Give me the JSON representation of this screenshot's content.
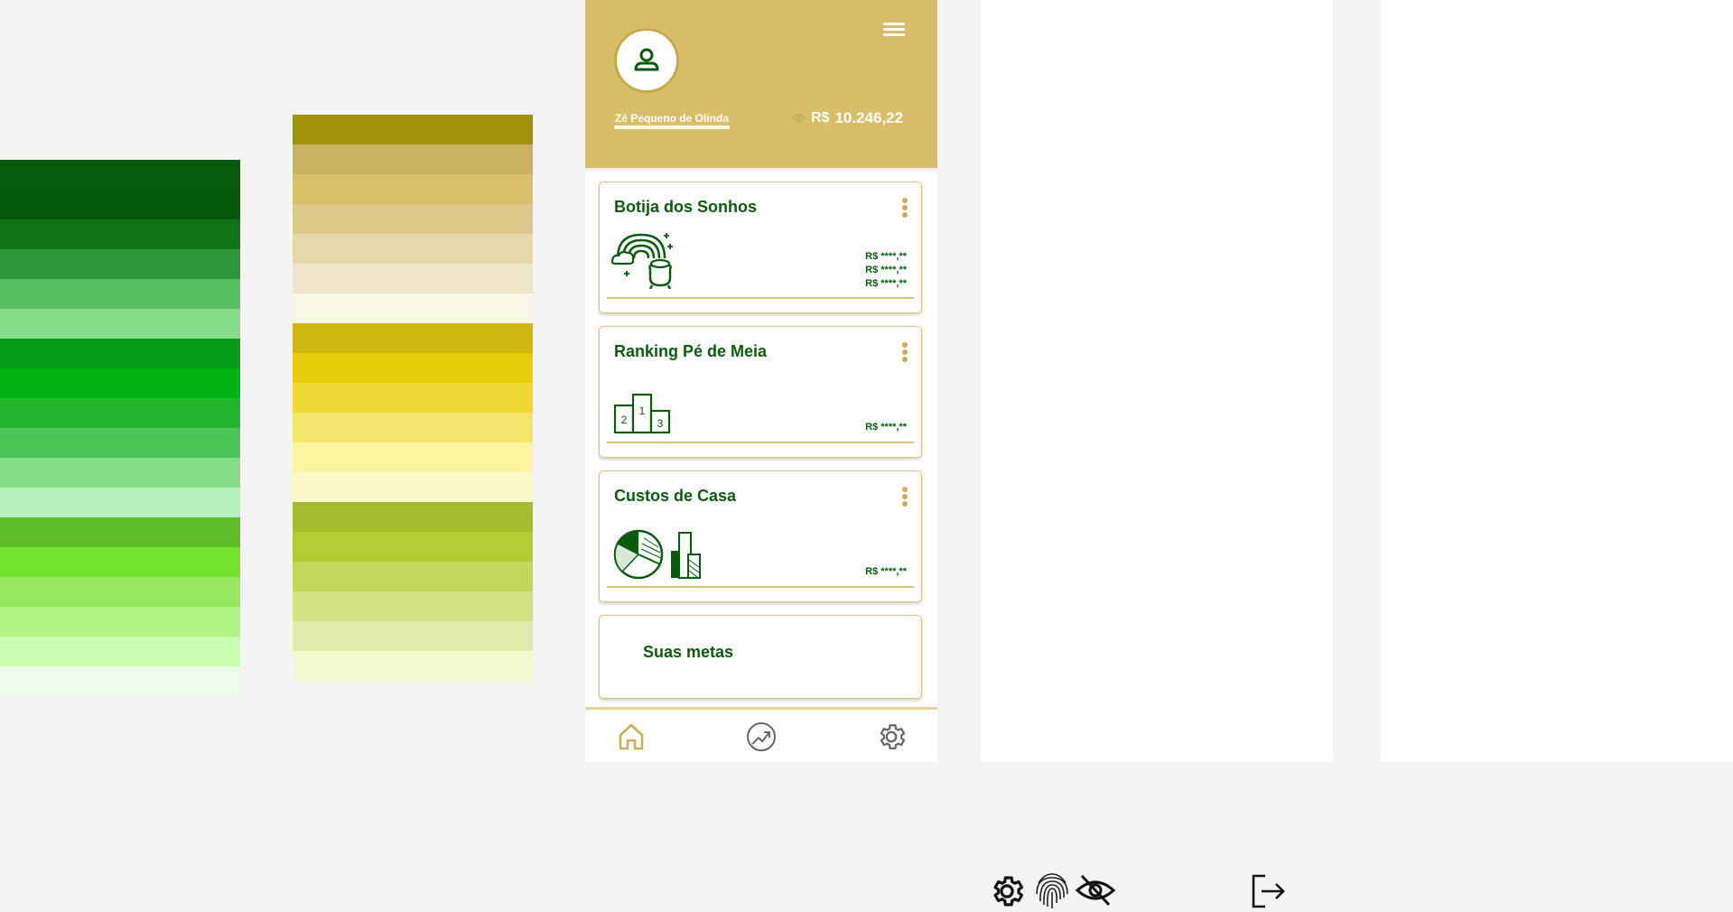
{
  "palette": {
    "greens": [
      "#055a0d",
      "#04590c",
      "#0f7418",
      "#2e963a",
      "#57c05f",
      "#87de8a",
      "#069b19",
      "#00b315",
      "#21b62e",
      "#4bc655",
      "#84dc88",
      "#b6f2bd",
      "#5dbe28",
      "#73e32c",
      "#98e960",
      "#b0f385",
      "#cbfdb0",
      "#ecffe8"
    ],
    "yellows_a": [
      "#a1920a",
      "#c9b261",
      "#d9c068",
      "#ddc98c",
      "#e5d8ac",
      "#efe5cb",
      "#fbf7e6"
    ],
    "yellows_b": [
      "#cfb611",
      "#e5cd07",
      "#eed934",
      "#f4e66d",
      "#fcf59f",
      "#fdf9cb"
    ],
    "yellows_c": [
      "#a6bc2d",
      "#b4cb31",
      "#c3d75d",
      "#d3e180",
      "#e0ebab",
      "#f2fbd0"
    ]
  },
  "header": {
    "user_name": "Zé Pequeno de Olinda",
    "currency": "R$",
    "balance": "10.246,22"
  },
  "cards": [
    {
      "title": "Botija dos Sonhos",
      "amounts": [
        "R$ ****,**",
        "R$ ****,**",
        "R$ ****,**"
      ]
    },
    {
      "title": "Ranking Pé de Meia",
      "amounts": [
        "R$ ****,**"
      ]
    },
    {
      "title": "Custos de Casa",
      "amounts": [
        "R$ ****,**"
      ]
    },
    {
      "title": "Suas metas"
    }
  ],
  "podium": {
    "first": "1",
    "second": "2",
    "third": "3"
  },
  "colors": {
    "brand_gold": "#d8be68",
    "brand_green": "#0c5a10",
    "border_gold": "#d9c37a"
  }
}
